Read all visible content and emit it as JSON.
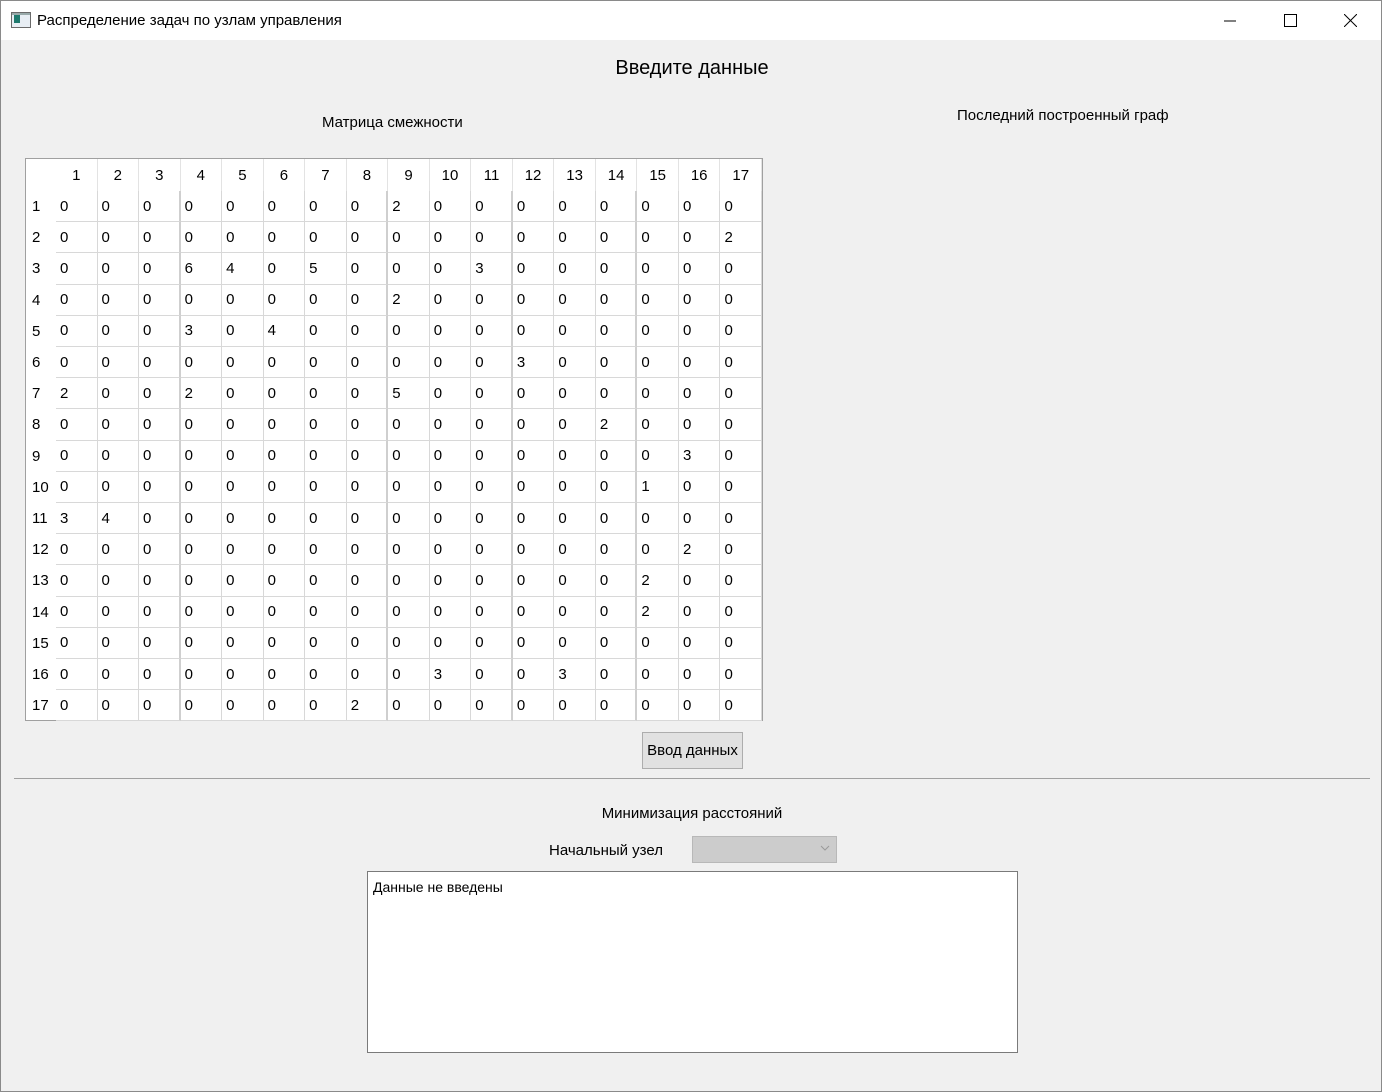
{
  "window": {
    "title": "Распределение задач по узлам управления"
  },
  "heading": "Введите данные",
  "matrix": {
    "label": "Матрица смежности",
    "col_headers": [
      "1",
      "2",
      "3",
      "4",
      "5",
      "6",
      "7",
      "8",
      "9",
      "10",
      "11",
      "12",
      "13",
      "14",
      "15",
      "16",
      "17"
    ],
    "row_headers": [
      "1",
      "2",
      "3",
      "4",
      "5",
      "6",
      "7",
      "8",
      "9",
      "10",
      "11",
      "12",
      "13",
      "14",
      "15",
      "16",
      "17"
    ],
    "rows": [
      [
        "0",
        "0",
        "0",
        "0",
        "0",
        "0",
        "0",
        "0",
        "2",
        "0",
        "0",
        "0",
        "0",
        "0",
        "0",
        "0",
        "0"
      ],
      [
        "0",
        "0",
        "0",
        "0",
        "0",
        "0",
        "0",
        "0",
        "0",
        "0",
        "0",
        "0",
        "0",
        "0",
        "0",
        "0",
        "2"
      ],
      [
        "0",
        "0",
        "0",
        "6",
        "4",
        "0",
        "5",
        "0",
        "0",
        "0",
        "3",
        "0",
        "0",
        "0",
        "0",
        "0",
        "0"
      ],
      [
        "0",
        "0",
        "0",
        "0",
        "0",
        "0",
        "0",
        "0",
        "2",
        "0",
        "0",
        "0",
        "0",
        "0",
        "0",
        "0",
        "0"
      ],
      [
        "0",
        "0",
        "0",
        "3",
        "0",
        "4",
        "0",
        "0",
        "0",
        "0",
        "0",
        "0",
        "0",
        "0",
        "0",
        "0",
        "0"
      ],
      [
        "0",
        "0",
        "0",
        "0",
        "0",
        "0",
        "0",
        "0",
        "0",
        "0",
        "0",
        "3",
        "0",
        "0",
        "0",
        "0",
        "0"
      ],
      [
        "2",
        "0",
        "0",
        "2",
        "0",
        "0",
        "0",
        "0",
        "5",
        "0",
        "0",
        "0",
        "0",
        "0",
        "0",
        "0",
        "0"
      ],
      [
        "0",
        "0",
        "0",
        "0",
        "0",
        "0",
        "0",
        "0",
        "0",
        "0",
        "0",
        "0",
        "0",
        "2",
        "0",
        "0",
        "0"
      ],
      [
        "0",
        "0",
        "0",
        "0",
        "0",
        "0",
        "0",
        "0",
        "0",
        "0",
        "0",
        "0",
        "0",
        "0",
        "0",
        "3",
        "0"
      ],
      [
        "0",
        "0",
        "0",
        "0",
        "0",
        "0",
        "0",
        "0",
        "0",
        "0",
        "0",
        "0",
        "0",
        "0",
        "1",
        "0",
        "0"
      ],
      [
        "3",
        "4",
        "0",
        "0",
        "0",
        "0",
        "0",
        "0",
        "0",
        "0",
        "0",
        "0",
        "0",
        "0",
        "0",
        "0",
        "0"
      ],
      [
        "0",
        "0",
        "0",
        "0",
        "0",
        "0",
        "0",
        "0",
        "0",
        "0",
        "0",
        "0",
        "0",
        "0",
        "0",
        "2",
        "0"
      ],
      [
        "0",
        "0",
        "0",
        "0",
        "0",
        "0",
        "0",
        "0",
        "0",
        "0",
        "0",
        "0",
        "0",
        "0",
        "2",
        "0",
        "0"
      ],
      [
        "0",
        "0",
        "0",
        "0",
        "0",
        "0",
        "0",
        "0",
        "0",
        "0",
        "0",
        "0",
        "0",
        "0",
        "2",
        "0",
        "0"
      ],
      [
        "0",
        "0",
        "0",
        "0",
        "0",
        "0",
        "0",
        "0",
        "0",
        "0",
        "0",
        "0",
        "0",
        "0",
        "0",
        "0",
        "0"
      ],
      [
        "0",
        "0",
        "0",
        "0",
        "0",
        "0",
        "0",
        "0",
        "0",
        "3",
        "0",
        "0",
        "3",
        "0",
        "0",
        "0",
        "0"
      ],
      [
        "0",
        "0",
        "0",
        "0",
        "0",
        "0",
        "0",
        "2",
        "0",
        "0",
        "0",
        "0",
        "0",
        "0",
        "0",
        "0",
        "0"
      ]
    ]
  },
  "graph_label": "Последний построенный граф",
  "input_button": "Ввод данных",
  "minimization": {
    "title": "Минимизация расстояний",
    "start_node_label": "Начальный узел",
    "start_node_value": "",
    "output_text": "Данные не введены"
  }
}
